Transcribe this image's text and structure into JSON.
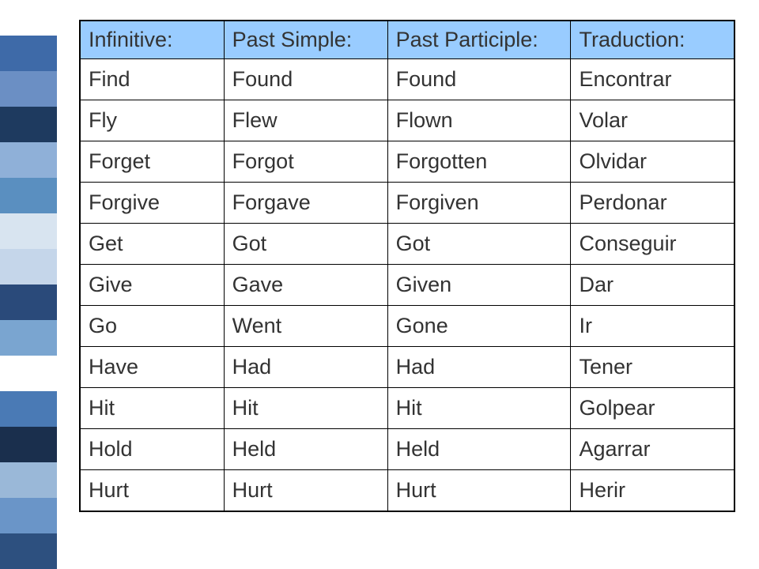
{
  "sidebar_colors": [
    "#ffffff",
    "#3e6aa8",
    "#6b8fc4",
    "#1e3a5f",
    "#8fb0d8",
    "#5a8fc0",
    "#d8e4f0",
    "#c5d6ea",
    "#2a4a7a",
    "#7aa5d0",
    "#ffffff",
    "#4a7ab5",
    "#1a2f4d",
    "#9ab8d8",
    "#6a95c8",
    "#2d507f"
  ],
  "table": {
    "headers": {
      "infinitive": "Infinitive:",
      "past_simple": "Past Simple:",
      "past_participle": "Past Participle:",
      "traduction": "Traduction:"
    },
    "rows": [
      {
        "infinitive": "find",
        "past_simple": "Found",
        "past_participle": "Found",
        "traduction": "encontrar"
      },
      {
        "infinitive": "fly",
        "past_simple": "Flew",
        "past_participle": "Flown",
        "traduction": "volar"
      },
      {
        "infinitive": "forget",
        "past_simple": "Forgot",
        "past_participle": "Forgotten",
        "traduction": "olvidar"
      },
      {
        "infinitive": "forgive",
        "past_simple": "Forgave",
        "past_participle": "Forgiven",
        "traduction": "perdonar"
      },
      {
        "infinitive": "get",
        "past_simple": "Got",
        "past_participle": "Got",
        "traduction": "conseguir"
      },
      {
        "infinitive": "give",
        "past_simple": "Gave",
        "past_participle": "Given",
        "traduction": "dar"
      },
      {
        "infinitive": "go",
        "past_simple": "Went",
        "past_participle": "Gone",
        "traduction": "ir"
      },
      {
        "infinitive": "have",
        "past_simple": "Had",
        "past_participle": "Had",
        "traduction": "tener"
      },
      {
        "infinitive": "hit",
        "past_simple": "Hit",
        "past_participle": "Hit",
        "traduction": "golpear"
      },
      {
        "infinitive": "hold",
        "past_simple": "Held",
        "past_participle": "Held",
        "traduction": "agarrar"
      },
      {
        "infinitive": "hurt",
        "past_simple": "Hurt",
        "past_participle": "Hurt",
        "traduction": "herir"
      }
    ]
  },
  "first_letter_case": "upper"
}
